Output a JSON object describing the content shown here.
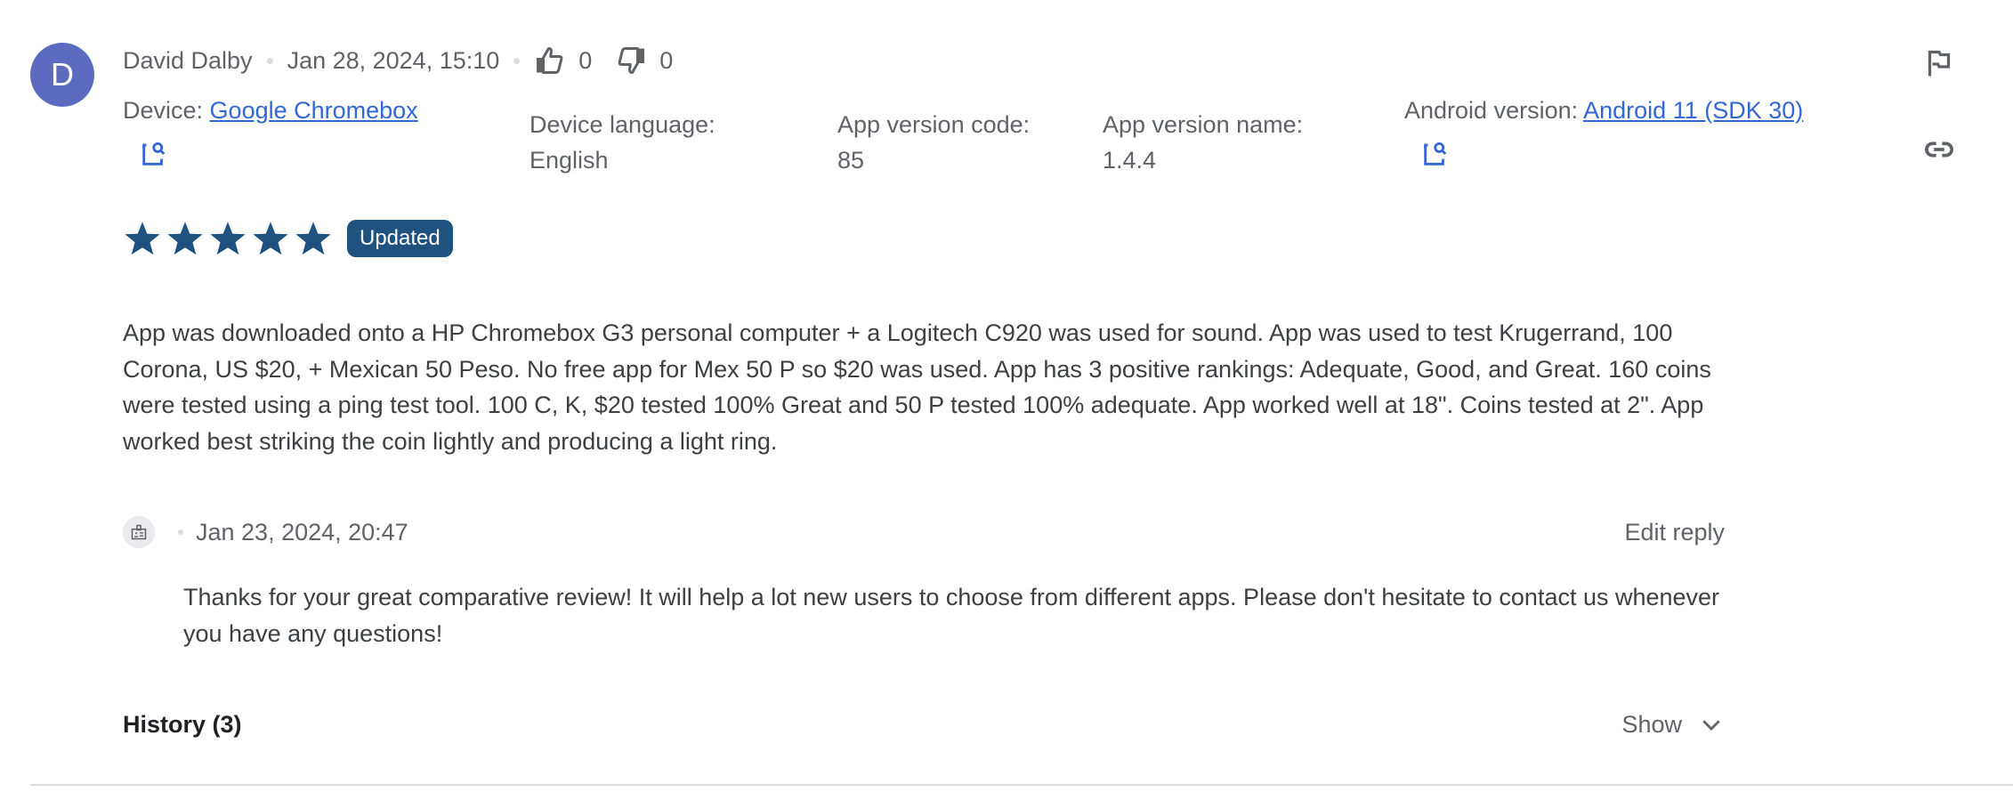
{
  "review": {
    "author_initial": "D",
    "author_name": "David Dalby",
    "date": "Jan 28, 2024, 15:10",
    "thumbs_up_count": "0",
    "thumbs_down_count": "0",
    "device_label": "Device:",
    "device_value": "Google Chromebox",
    "device_language_label": "Device language:",
    "device_language_value": "English",
    "app_version_code_label": "App version code:",
    "app_version_code_value": "85",
    "app_version_name_label": "App version name:",
    "app_version_name_value": "1.4.4",
    "android_version_label": "Android version:",
    "android_version_value": "Android 11 (SDK 30)",
    "rating": 5,
    "rating_max": 5,
    "badge": "Updated",
    "text": "App was downloaded onto a HP Chromebox G3 personal computer + a Logitech C920 was used for sound. App was used to test Krugerrand, 100 Corona, US $20, + Mexican 50 Peso. No free app for Mex 50 P so $20 was used. App has 3 positive rankings: Adequate, Good, and Great. 160 coins were tested using a ping test tool. 100 C, K, $20 tested 100% Great and 50 P tested 100% adequate. App worked well at 18\". Coins tested at 2\". App worked best striking the coin lightly and producing a light ring."
  },
  "reply": {
    "date": "Jan 23, 2024, 20:47",
    "edit_label": "Edit reply",
    "text": "Thanks for your great comparative review! It will help a lot new users to choose from different apps. Please don't hesitate to contact us whenever you have any questions!"
  },
  "history": {
    "label": "History (3)",
    "show_label": "Show"
  },
  "icons": {
    "thumbs_up": "thumbs-up-icon",
    "thumbs_down": "thumbs-down-icon",
    "flag": "flag-icon",
    "link": "link-icon",
    "search_device": "image-search-icon",
    "reply_avatar": "developer-badge-icon",
    "chevron": "chevron-down-icon",
    "star": "star-icon"
  },
  "colors": {
    "avatar": "#5c6bc0",
    "link": "#3367d6",
    "star": "#20527f",
    "badge_bg": "#20527f",
    "text": "#3c4043",
    "secondary": "#5f6368"
  }
}
